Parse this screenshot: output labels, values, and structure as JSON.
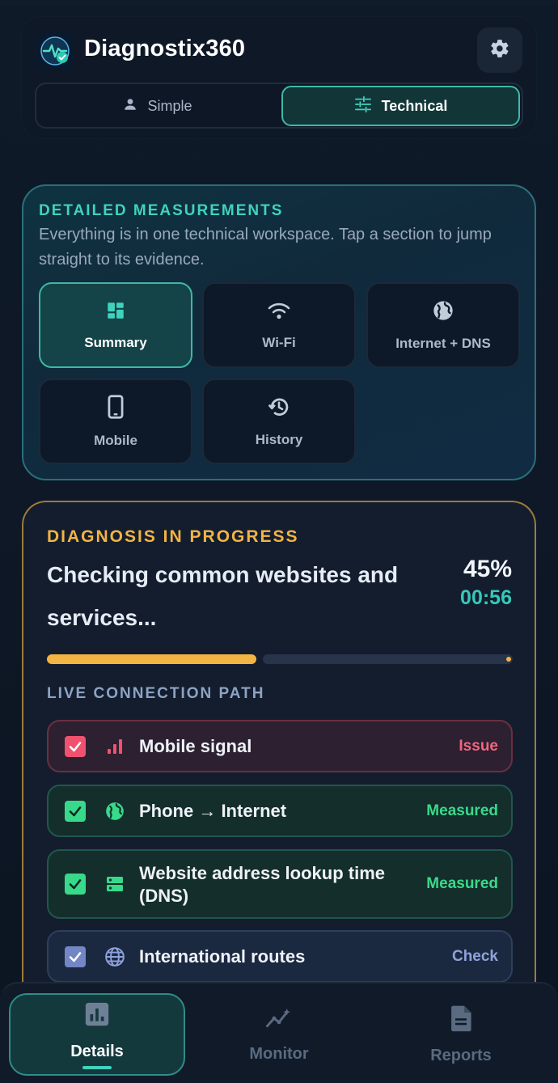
{
  "app": {
    "title": "Diagnostix360",
    "logo_icon": "network-check-logo",
    "settings_icon": "gear-icon"
  },
  "mode_toggle": {
    "options": [
      {
        "label": "Simple",
        "icon": "person-icon",
        "selected": false
      },
      {
        "label": "Technical",
        "icon": "sliders-icon",
        "selected": true
      }
    ]
  },
  "measurements": {
    "eyebrow": "DETAILED MEASUREMENTS",
    "description": "Everything is in one technical workspace. Tap a section to jump straight to its evidence.",
    "tiles": [
      {
        "label": "Summary",
        "icon": "dashboard-icon",
        "active": true
      },
      {
        "label": "Wi-Fi",
        "icon": "wifi-icon",
        "active": false
      },
      {
        "label": "Internet + DNS",
        "icon": "globe-icon",
        "active": false
      },
      {
        "label": "Mobile",
        "icon": "phone-icon",
        "active": false
      },
      {
        "label": "History",
        "icon": "history-icon",
        "active": false
      }
    ]
  },
  "diagnosis": {
    "eyebrow": "DIAGNOSIS IN PROGRESS",
    "title": "Checking common websites and services...",
    "percent_text": "45%",
    "progress": 0.45,
    "timer": "00:56",
    "path_eyebrow": "LIVE CONNECTION PATH",
    "steps": [
      {
        "label": "Mobile signal",
        "status": "Issue",
        "icon": "signal-bars-icon",
        "state": "issue"
      },
      {
        "label": "Phone → Internet",
        "status": "Measured",
        "icon": "globe-icon",
        "state": "ok"
      },
      {
        "label": "Website address lookup time (DNS)",
        "status": "Measured",
        "icon": "dns-icon",
        "state": "ok"
      },
      {
        "label": "International routes",
        "status": "Check",
        "icon": "world-grid-icon",
        "state": "check"
      }
    ]
  },
  "colors": {
    "accent_teal": "#3fd3bd",
    "warning_amber": "#f2b443",
    "issue_red": "#f0516f",
    "ok_green": "#38d98a",
    "check_blue": "#7386c5"
  },
  "bottom_nav": {
    "items": [
      {
        "label": "Details",
        "icon": "bar-chart-icon",
        "active": true
      },
      {
        "label": "Monitor",
        "icon": "trend-icon",
        "active": false
      },
      {
        "label": "Reports",
        "icon": "document-icon",
        "active": false
      }
    ]
  }
}
